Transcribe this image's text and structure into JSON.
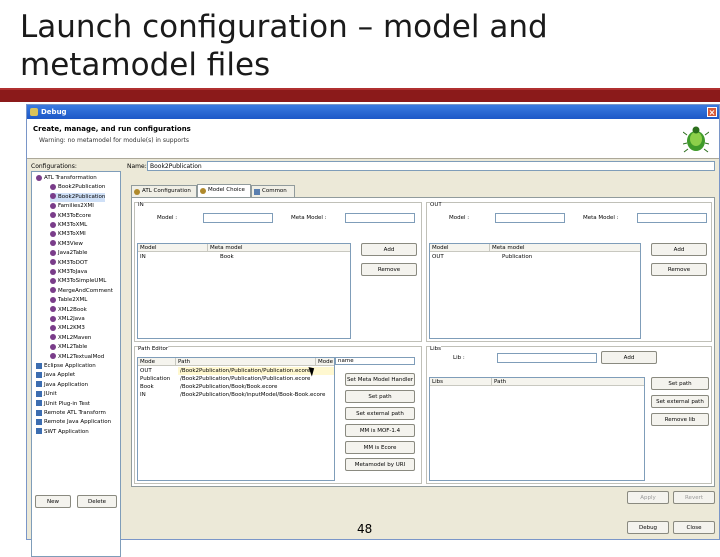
{
  "slide": {
    "title": "Launch configuration – model and metamodel files",
    "page_number": "48"
  },
  "window": {
    "title": "Debug",
    "header_title": "Create, manage, and run configurations",
    "header_message": "Warning: no metamodel for module(s) in supports"
  },
  "tree": {
    "label": "Configurations:",
    "items": [
      "ATL Transformation",
      "Book2Publication",
      "Book2Publication",
      "Families2XMI",
      "KM3ToEcore",
      "KM3ToXML",
      "KM3ToXMI",
      "KM3View",
      "Java2Table",
      "KM3ToDOT",
      "KM3ToJava",
      "KM3ToSimpleUML",
      "MergeAndComment",
      "Table2XML",
      "XML2Book",
      "XML2Java",
      "XML2KM3",
      "XML2Maven",
      "XML2Table",
      "XML2TextualMod",
      "Eclipse Application",
      "Java Applet",
      "Java Application",
      "JUnit",
      "JUnit Plug-in Test",
      "Remote ATL Transform",
      "Remote Java Application",
      "SWT Application"
    ],
    "new_button": "New",
    "delete_button": "Delete"
  },
  "config": {
    "name_label": "Name:",
    "name_value": "Book2Publication",
    "tabs": [
      "ATL Configuration",
      "Model Choice",
      "Common"
    ],
    "in_group": {
      "label": "IN",
      "model_label": "Model :",
      "metamodel_label": "Meta Model :",
      "columns": [
        "Model",
        "Meta model"
      ],
      "rows": [
        [
          "IN",
          "Book"
        ]
      ],
      "add_button": "Add",
      "remove_button": "Remove"
    },
    "out_group": {
      "label": "OUT",
      "model_label": "Model :",
      "metamodel_label": "Meta Model :",
      "columns": [
        "Model",
        "Meta model"
      ],
      "rows": [
        [
          "OUT",
          "Publication"
        ]
      ],
      "add_button": "Add",
      "remove_button": "Remove"
    },
    "path_editor": {
      "label": "Path Editor",
      "columns": [
        "Mode",
        "Path",
        "Mode"
      ],
      "extra_column": "name",
      "rows": [
        [
          "OUT",
          "/Book2Publication/Publication/Publication.ecore"
        ],
        [
          "Publication",
          "/Book2Publication/Publication/Publication.ecore"
        ],
        [
          "Book",
          "/Book2Publication/Book/Book.ecore"
        ],
        [
          "IN",
          "/Book2Publication/Book/inputModel/Book-Book.ecore"
        ]
      ],
      "buttons": [
        "Set Meta Model Handler",
        "Set path",
        "Set external path",
        "MM is MOF-1.4",
        "MM is Ecore",
        "Metamodel by URI"
      ]
    },
    "libs": {
      "label": "Libs",
      "lib_label": "Lib :",
      "add_button": "Add",
      "columns": [
        "Libs",
        "Path"
      ],
      "buttons": [
        "Set path",
        "Set external path",
        "Remove lib"
      ]
    }
  },
  "footer": {
    "apply_button": "Apply",
    "revert_button": "Revert",
    "debug_button": "Debug",
    "close_button": "Close"
  },
  "colors": {
    "banner": "#8b1a1a",
    "titlebar": "#1d58c7",
    "window_bg": "#ece9d8"
  }
}
